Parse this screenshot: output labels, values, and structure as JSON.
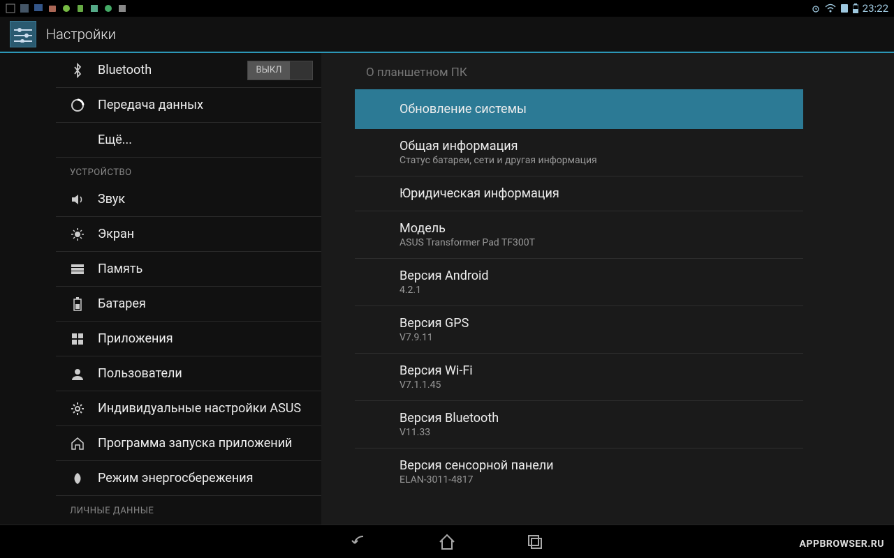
{
  "statusBar": {
    "time": "23:22"
  },
  "header": {
    "title": "Настройки"
  },
  "sidebar": {
    "items": [
      {
        "label": "Bluetooth",
        "toggle": "ВЫКЛ"
      },
      {
        "label": "Передача данных"
      },
      {
        "label": "Ещё..."
      }
    ],
    "section1": "УСТРОЙСТВО",
    "deviceItems": [
      {
        "label": "Звук"
      },
      {
        "label": "Экран"
      },
      {
        "label": "Память"
      },
      {
        "label": "Батарея"
      },
      {
        "label": "Приложения"
      },
      {
        "label": "Пользователи"
      },
      {
        "label": "Индивидуальные настройки ASUS"
      },
      {
        "label": "Программа запуска приложений"
      },
      {
        "label": "Режим энергосбережения"
      }
    ],
    "section2": "ЛИЧНЫЕ ДАННЫЕ"
  },
  "main": {
    "header": "О планшетном ПК",
    "items": [
      {
        "title": "Обновление системы",
        "selected": true
      },
      {
        "title": "Общая информация",
        "subtitle": "Статус батареи, сети и другая информация"
      },
      {
        "title": "Юридическая информация"
      },
      {
        "title": "Модель",
        "subtitle": "ASUS Transformer Pad TF300T"
      },
      {
        "title": "Версия Android",
        "subtitle": "4.2.1"
      },
      {
        "title": "Версия GPS",
        "subtitle": "V7.9.11"
      },
      {
        "title": "Версия Wi-Fi",
        "subtitle": "V7.1.1.45"
      },
      {
        "title": "Версия Bluetooth",
        "subtitle": "V11.33"
      },
      {
        "title": "Версия сенсорной панели",
        "subtitle": "ELAN-3011-4817"
      }
    ]
  },
  "watermark": "APPBROWSER.RU"
}
